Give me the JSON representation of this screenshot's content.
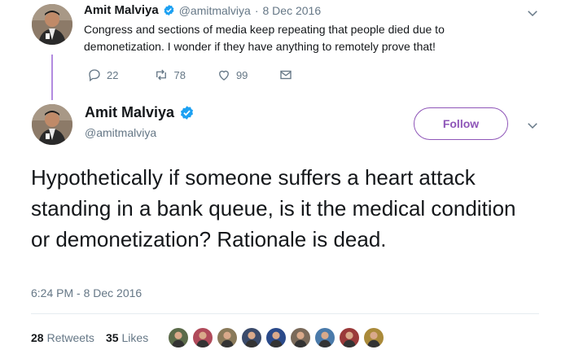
{
  "parent_tweet": {
    "name": "Amit Malviya",
    "handle": "@amitmalviya",
    "separator": "·",
    "date": "8 Dec 2016",
    "text": "Congress and sections of media keep repeating that people died due to demonetization. I wonder if they have anything to remotely prove that!",
    "replies": "22",
    "retweets": "78",
    "likes": "99"
  },
  "main_tweet": {
    "name": "Amit Malviya",
    "handle": "@amitmalviya",
    "follow_label": "Follow",
    "text": "Hypothetically if someone suffers a heart attack standing in a bank queue, is it the medical condition or demonetization? Rationale is dead.",
    "timestamp": "6:24 PM - 8 Dec 2016",
    "retweet_count": "28",
    "retweet_label": "Retweets",
    "like_count": "35",
    "like_label": "Likes"
  },
  "colors": {
    "accent": "#8e55b8",
    "verified": "#1da1f2",
    "thread_line": "#b28be0",
    "muted_text": "#657786"
  },
  "icons": {
    "reply": "reply-icon",
    "retweet": "retweet-icon",
    "like": "heart-icon",
    "dm": "envelope-icon",
    "more": "chevron-down-icon",
    "verified": "verified-badge-icon"
  },
  "liker_avatar_colors": [
    "#5b6b4a",
    "#b04a5a",
    "#8a7a5a",
    "#3a4a6a",
    "#2a4a8a",
    "#7a6a5a",
    "#4a7aaa",
    "#9a3a3a",
    "#aa8a3a"
  ]
}
